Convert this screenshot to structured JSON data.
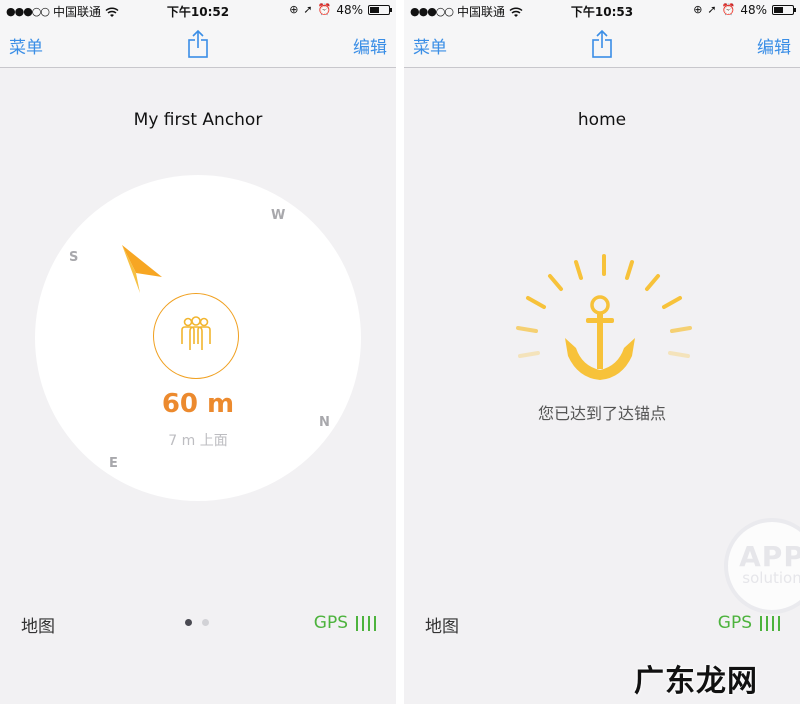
{
  "screens": [
    {
      "status": {
        "signal_dots": "●●●○○",
        "carrier": "中国联通",
        "time": "下午10:52",
        "battery_text": "48%",
        "battery_level": 0.48
      },
      "nav": {
        "left_label": "菜单",
        "right_label": "编辑",
        "center_icon": "share-icon"
      },
      "title": "My first Anchor",
      "compass": {
        "directions": {
          "north": "N",
          "south": "S",
          "east": "E",
          "west": "W"
        },
        "distance": "60 m",
        "sub": "7 m 上面",
        "pointer_icon": "direction-arrow-icon",
        "center_icon": "people-group-icon"
      },
      "bottom": {
        "left_label": "地图",
        "gps_label": "GPS",
        "page_count": 2,
        "active_page": 1
      }
    },
    {
      "status": {
        "signal_dots": "●●●○○",
        "carrier": "中国联通",
        "time": "下午10:53",
        "battery_text": "48%",
        "battery_level": 0.48
      },
      "nav": {
        "left_label": "菜单",
        "right_label": "编辑",
        "center_icon": "share-icon"
      },
      "title": "home",
      "arrived_text": "您已达到了达锚点",
      "arrived_icon": "anchor-icon",
      "bottom": {
        "left_label": "地图",
        "gps_label": "GPS"
      }
    }
  ],
  "overlay": {
    "badge_title": "APP",
    "badge_sub": "solution",
    "watermark": "广东龙网"
  },
  "colors": {
    "accent_blue": "#3a8ee6",
    "distance_orange": "#ec8a2e",
    "anchor_gold": "#f7c23a",
    "gps_green": "#4db33d",
    "background": "#f2f1f3"
  }
}
